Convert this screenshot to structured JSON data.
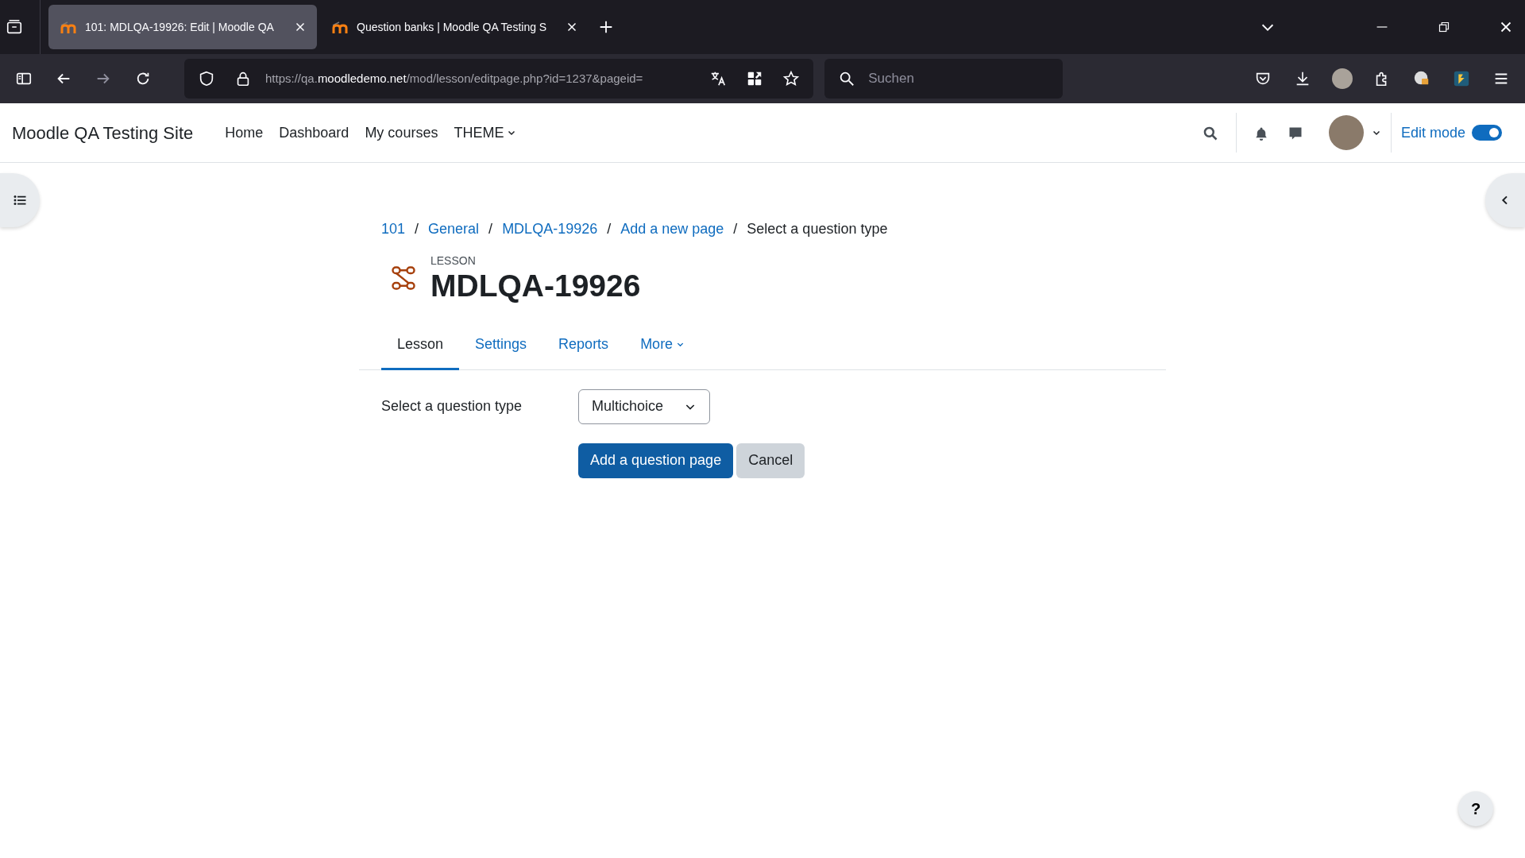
{
  "browser": {
    "tabs": [
      {
        "title": "101: MDLQA-19926: Edit | Moodle QA",
        "selected": true
      },
      {
        "title": "Question banks | Moodle QA Testing S",
        "selected": false
      }
    ],
    "url": {
      "scheme": "https://qa.",
      "domain": "moodledemo.net",
      "path": "/mod/lesson/editpage.php?id=1237&pageid="
    },
    "search": {
      "placeholder": "Suchen"
    }
  },
  "site": {
    "name": "Moodle QA Testing Site",
    "nav": [
      {
        "label": "Home",
        "kind": "link"
      },
      {
        "label": "Dashboard",
        "kind": "link"
      },
      {
        "label": "My courses",
        "kind": "link"
      },
      {
        "label": "THEME",
        "kind": "dropdown"
      }
    ],
    "edit_mode": {
      "label": "Edit mode",
      "on": true
    }
  },
  "breadcrumb": [
    {
      "label": "101",
      "link": true
    },
    {
      "separator": "/",
      "label": "General",
      "link": true
    },
    {
      "separator": "/",
      "label": "MDLQA-19926",
      "link": true
    },
    {
      "separator": "/",
      "label": "Add a new page",
      "link": true
    },
    {
      "separator": "/",
      "label": "Select a question type",
      "link": false
    }
  ],
  "header": {
    "module": "LESSON",
    "title": "MDLQA-19926"
  },
  "tabs": [
    {
      "label": "Lesson",
      "selected": true,
      "kind": "link"
    },
    {
      "label": "Settings",
      "selected": false,
      "kind": "link"
    },
    {
      "label": "Reports",
      "selected": false,
      "kind": "link"
    },
    {
      "label": "More",
      "selected": false,
      "kind": "dropdown"
    }
  ],
  "form": {
    "label": "Select a question type",
    "value": "Multichoice",
    "buttons": [
      {
        "label": "Add a question page",
        "kind": "primary"
      },
      {
        "label": "Cancel",
        "kind": "secondary"
      }
    ]
  },
  "help": {
    "label": "?"
  }
}
